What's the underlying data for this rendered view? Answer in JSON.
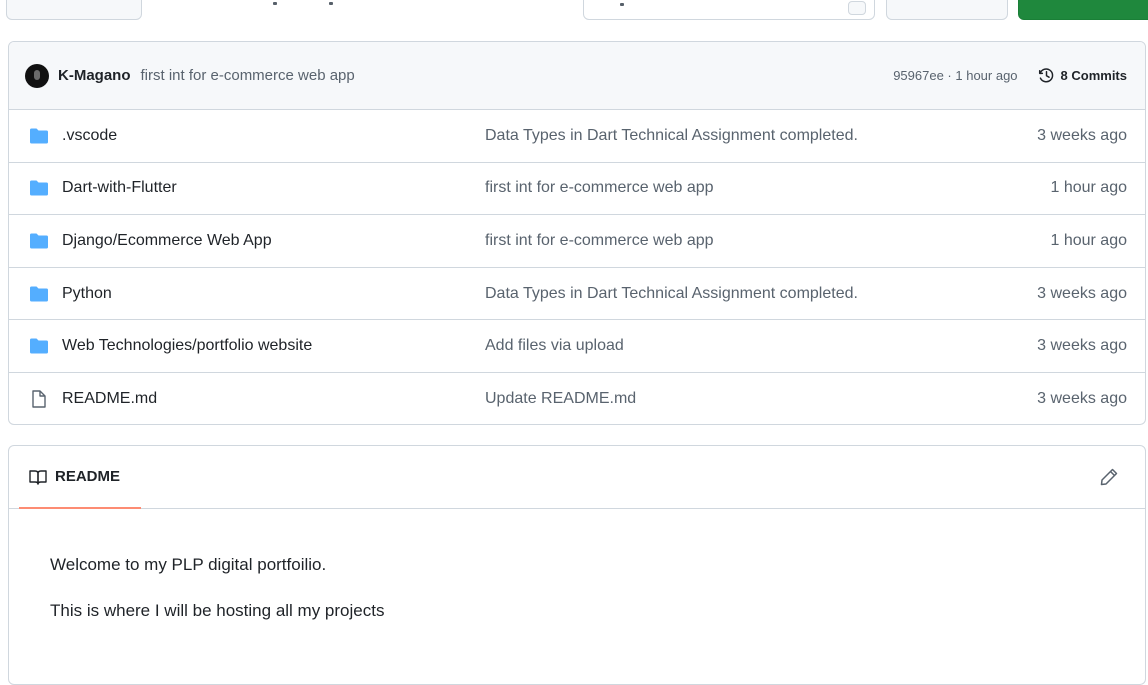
{
  "latest_commit": {
    "author": "K-Magano",
    "message": "first int for e-commerce web app",
    "meta": "95967ee · 1 hour ago",
    "commits_label": "8 Commits"
  },
  "files": [
    {
      "type": "folder",
      "name": ".vscode",
      "message": "Data Types in Dart Technical Assignment completed.",
      "age": "3 weeks ago"
    },
    {
      "type": "folder",
      "name": "Dart-with-Flutter",
      "message": "first int for e-commerce web app",
      "age": "1 hour ago"
    },
    {
      "type": "folder",
      "name": "Django/Ecommerce Web App",
      "message": "first int for e-commerce web app",
      "age": "1 hour ago"
    },
    {
      "type": "folder",
      "name": "Python",
      "message": "Data Types in Dart Technical Assignment completed.",
      "age": "3 weeks ago"
    },
    {
      "type": "folder",
      "name": "Web Technologies/portfolio website",
      "message": "Add files via upload",
      "age": "3 weeks ago"
    },
    {
      "type": "file",
      "name": "README.md",
      "message": "Update README.md",
      "age": "3 weeks ago"
    }
  ],
  "readme": {
    "tab_label": "README",
    "paragraphs": [
      "Welcome to my PLP digital portfoilio.",
      "This is where I will be hosting all my projects"
    ]
  },
  "colors": {
    "folder": "#54aeff",
    "accent_underline": "#fd8c73",
    "primary_button": "#1f883d"
  },
  "icons": {
    "folder": "folder-icon",
    "file": "file-icon",
    "history": "history-icon",
    "book": "book-icon",
    "edit": "pencil-icon"
  }
}
